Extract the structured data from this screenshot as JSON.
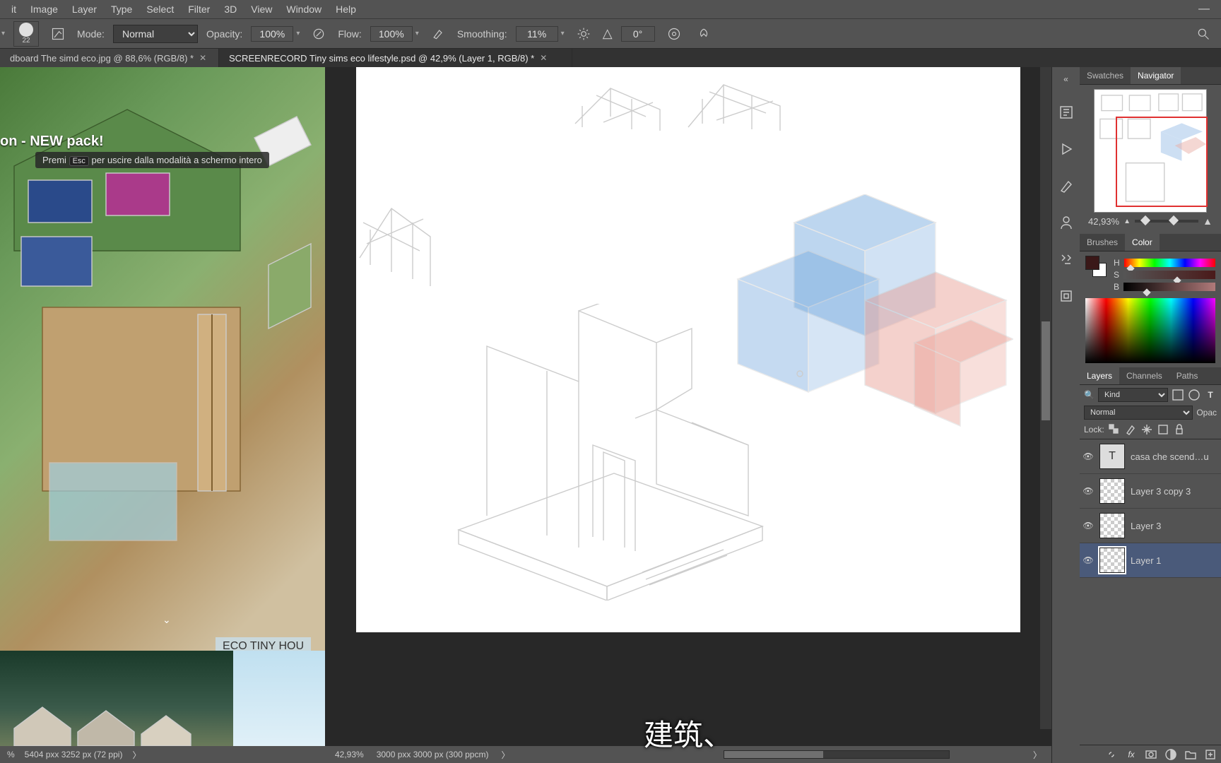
{
  "menu": {
    "items": [
      "it",
      "Image",
      "Layer",
      "Type",
      "Select",
      "Filter",
      "3D",
      "View",
      "Window",
      "Help"
    ]
  },
  "options": {
    "brush_size": "22",
    "mode_label": "Mode:",
    "mode_value": "Normal",
    "opacity_label": "Opacity:",
    "opacity_value": "100%",
    "flow_label": "Flow:",
    "flow_value": "100%",
    "smoothing_label": "Smoothing:",
    "smoothing_value": "11%",
    "angle_value": "0°",
    "angle_icon": "△"
  },
  "tabs": [
    {
      "title": "dboard The simd eco.jpg @ 88,6% (RGB/8) *",
      "active": false
    },
    {
      "title": "SCREENRECORD Tiny sims eco lifestyle.psd @ 42,9% (Layer 1, RGB/8) *",
      "active": true
    }
  ],
  "left_reference": {
    "headline": "on - NEW pack!",
    "hint_prefix": "Premi",
    "hint_key": "Esc",
    "hint_suffix": "per uscire dalla modalità a schermo intero",
    "bottom_label": "ECO TINY HOU",
    "status_zoom": "%",
    "status_dims": "5404 pxx 3252 px (72 ppi)",
    "status_arrow": "〉"
  },
  "center": {
    "status_zoom": "42,93%",
    "status_dims": "3000 pxx 3000 px (300 ppcm)",
    "status_arrow": "〉",
    "subtitle": "建筑、"
  },
  "right_strip_gripper": "«",
  "panels": {
    "swatches_tab": "Swatches",
    "navigator_tab": "Navigator",
    "navigator": {
      "zoom": "42,93%"
    },
    "brushes_tab": "Brushes",
    "color_tab": "Color",
    "color": {
      "h_label": "H",
      "s_label": "S",
      "b_label": "B"
    },
    "layers_tab": "Layers",
    "channels_tab": "Channels",
    "paths_tab": "Paths",
    "layers": {
      "kind_value": "Kind",
      "blend_value": "Normal",
      "opac_label": "Opac",
      "lock_label": "Lock:",
      "items": [
        {
          "name": "casa che scend…u",
          "type": "T"
        },
        {
          "name": "Layer 3 copy 3",
          "type": "checker"
        },
        {
          "name": "Layer 3",
          "type": "checker"
        },
        {
          "name": "Layer 1",
          "type": "checker",
          "selected": true
        }
      ]
    }
  }
}
